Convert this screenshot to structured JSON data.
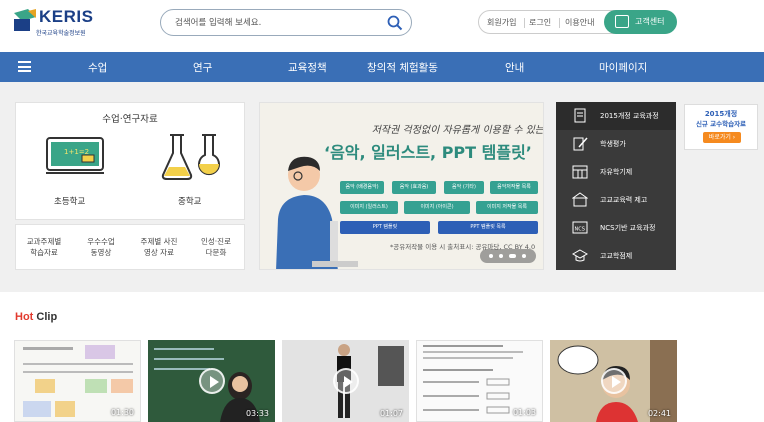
{
  "header": {
    "logo_text": "KERIS",
    "logo_sub": "한국교육학술정보원",
    "search_placeholder": "검색어를 입력해 보세요.",
    "util_links": [
      "회원가입",
      "로그인",
      "이용안내"
    ],
    "cs_label": "고객센터"
  },
  "nav": {
    "items": [
      "수업",
      "연구",
      "교육정책",
      "창의적 체험활동",
      "안내",
      "마이페이지"
    ]
  },
  "resources": {
    "title": "수업·연구자료",
    "elementary": "초등학교",
    "middle": "중학교",
    "blackboard_text": "1+1=2",
    "categories": [
      {
        "line1": "교과주제별",
        "line2": "학습자료"
      },
      {
        "line1": "우수수업",
        "line2": "동영상"
      },
      {
        "line1": "주제별 사진",
        "line2": "영상 자료"
      },
      {
        "line1": "인성·진로",
        "line2": "다문화"
      }
    ]
  },
  "banner": {
    "subtitle": "저작권 걱정없이 자유롭게 이용할 수 있는",
    "title": "‘음악, 일러스트, PPT 템플릿’",
    "buttons": [
      "음악 (배경음악)",
      "음악 (효과음)",
      "음악 (기타)",
      "음악저작물 목록",
      "이미지 (일러스트)",
      "이미지 (아이콘)",
      "이미지 저작물 목록",
      "PPT 템플릿",
      "PPT 템플릿 목록"
    ],
    "note": "*공유저작물 이용 시 출처표시: 공유마당, CC BY 4.0"
  },
  "quick_menu": {
    "items": [
      "2015개정 교육과정",
      "학생평가",
      "자유학기제",
      "고교교육력 제고",
      "NCS기반 교육과정",
      "고교학점제"
    ]
  },
  "promo": {
    "line1": "2015개정",
    "line2": "신규 교수학습자료",
    "button": "바로가기 ›"
  },
  "hot_clip": {
    "title_red": "Hot",
    "title_rest": " Clip",
    "clips": [
      {
        "duration": "01:30"
      },
      {
        "duration": "03:33"
      },
      {
        "duration": "01:07"
      },
      {
        "duration": "01:03"
      },
      {
        "duration": "02:41"
      }
    ]
  },
  "colors": {
    "nav_bg": "#3a6fb6",
    "teal": "#35a192",
    "hot_red": "#e23a2e",
    "quick_bg": "#3a3a3a",
    "promo_orange": "#f58a1f"
  },
  "icons": [
    "search-icon",
    "customer-center-icon",
    "menu-icon",
    "blackboard-icon",
    "flask-icon",
    "play-icon"
  ]
}
